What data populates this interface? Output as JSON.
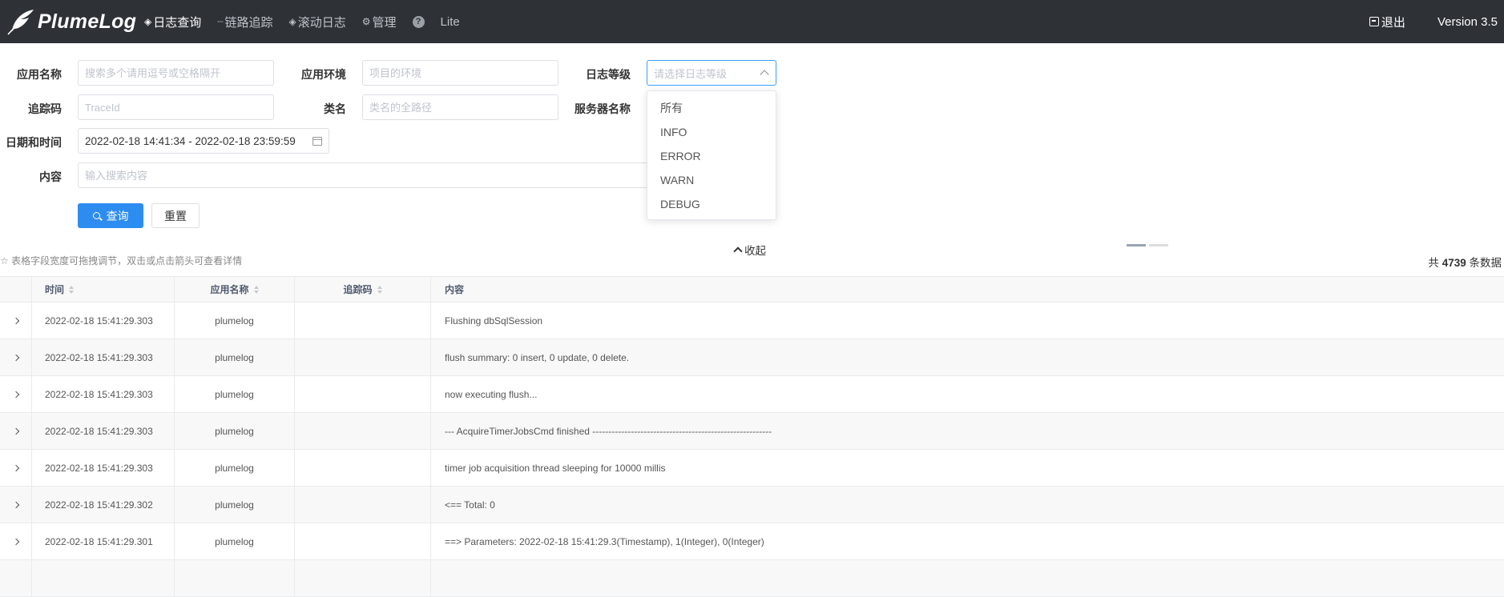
{
  "app": {
    "name": "PlumeLog",
    "version": "Version 3.5"
  },
  "nav": {
    "items": [
      {
        "label": "日志查询",
        "icon": "layers-icon",
        "active": true
      },
      {
        "label": "链路追踪",
        "icon": "trace-icon",
        "active": false
      },
      {
        "label": "滚动日志",
        "icon": "layers-icon",
        "active": false
      },
      {
        "label": "管理",
        "icon": "gear-icon",
        "active": false
      }
    ],
    "help": "?",
    "lite": "Lite",
    "logout": "退出"
  },
  "form": {
    "app_name": {
      "label": "应用名称",
      "placeholder": "搜索多个请用逗号或空格隔开"
    },
    "env": {
      "label": "应用环境",
      "placeholder": "项目的环境"
    },
    "level": {
      "label": "日志等级",
      "placeholder": "请选择日志等级"
    },
    "trace": {
      "label": "追踪码",
      "placeholder": "TraceId"
    },
    "class": {
      "label": "类名",
      "placeholder": "类名的全路径"
    },
    "server": {
      "label": "服务器名称"
    },
    "date": {
      "label": "日期和时间",
      "value": "2022-02-18 14:41:34 - 2022-02-18 23:59:59"
    },
    "content": {
      "label": "内容",
      "placeholder": "输入搜索内容"
    },
    "query_label": "查询",
    "reset_label": "重置"
  },
  "level_options": [
    "所有",
    "INFO",
    "ERROR",
    "WARN",
    "DEBUG"
  ],
  "info": {
    "hint": "☆ 表格字段宽度可拖拽调节，双击或点击箭头可查看详情",
    "collapse": "收起",
    "count_prefix": "共",
    "count": "4739",
    "count_suffix": "条数据"
  },
  "table": {
    "headers": {
      "time": "时间",
      "app": "应用名称",
      "trace": "追踪码",
      "content": "内容"
    },
    "rows": [
      {
        "time": "2022-02-18 15:41:29.303",
        "app": "plumelog",
        "trace": "",
        "content": "Flushing dbSqlSession"
      },
      {
        "time": "2022-02-18 15:41:29.303",
        "app": "plumelog",
        "trace": "",
        "content": "flush summary: 0 insert, 0 update, 0 delete."
      },
      {
        "time": "2022-02-18 15:41:29.303",
        "app": "plumelog",
        "trace": "",
        "content": "now executing flush..."
      },
      {
        "time": "2022-02-18 15:41:29.303",
        "app": "plumelog",
        "trace": "",
        "content": "--- AcquireTimerJobsCmd finished --------------------------------------------------------"
      },
      {
        "time": "2022-02-18 15:41:29.303",
        "app": "plumelog",
        "trace": "",
        "content": "timer job acquisition thread sleeping for 10000 millis"
      },
      {
        "time": "2022-02-18 15:41:29.302",
        "app": "plumelog",
        "trace": "",
        "content": "<== Total: 0"
      },
      {
        "time": "2022-02-18 15:41:29.301",
        "app": "plumelog",
        "trace": "",
        "content": "==> Parameters: 2022-02-18 15:41:29.3(Timestamp), 1(Integer), 0(Integer)"
      }
    ]
  },
  "colors": {
    "topbar": "#2e3237",
    "primary": "#2d8cf0",
    "select_focus": "#409eff"
  }
}
